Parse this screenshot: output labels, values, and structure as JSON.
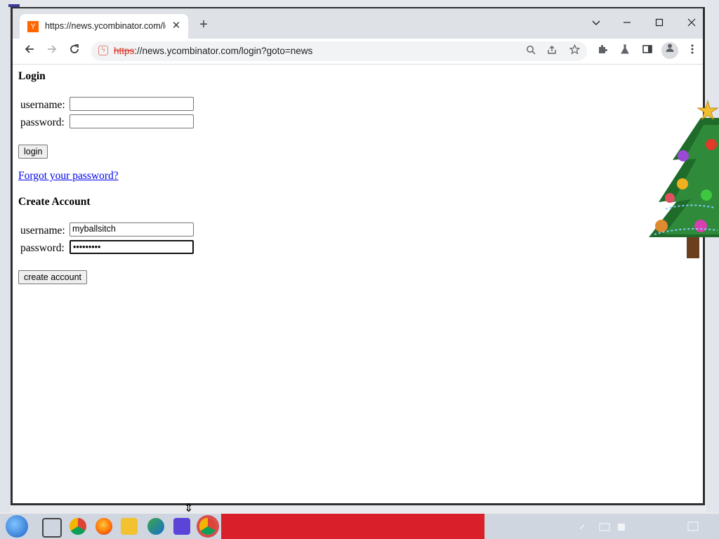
{
  "browser": {
    "tab": {
      "favicon_letter": "Y",
      "title": "https://news.ycombinator.com/login?goto=news"
    },
    "url": {
      "scheme": "https",
      "rest": "://news.ycombinator.com/login?goto=news"
    }
  },
  "page": {
    "login": {
      "heading": "Login",
      "username_label": "username:",
      "password_label": "password:",
      "username_value": "",
      "password_value": "",
      "button_label": "login"
    },
    "forgot_link": "Forgot your password?",
    "create": {
      "heading": "Create Account",
      "username_label": "username:",
      "password_label": "password:",
      "username_value": "myballsitch",
      "password_value": "•••••••••",
      "button_label": "create account"
    }
  },
  "colors": {
    "hn_orange": "#ff6600",
    "link_blue": "#0000ee",
    "taskbar_red": "#d9202a"
  }
}
